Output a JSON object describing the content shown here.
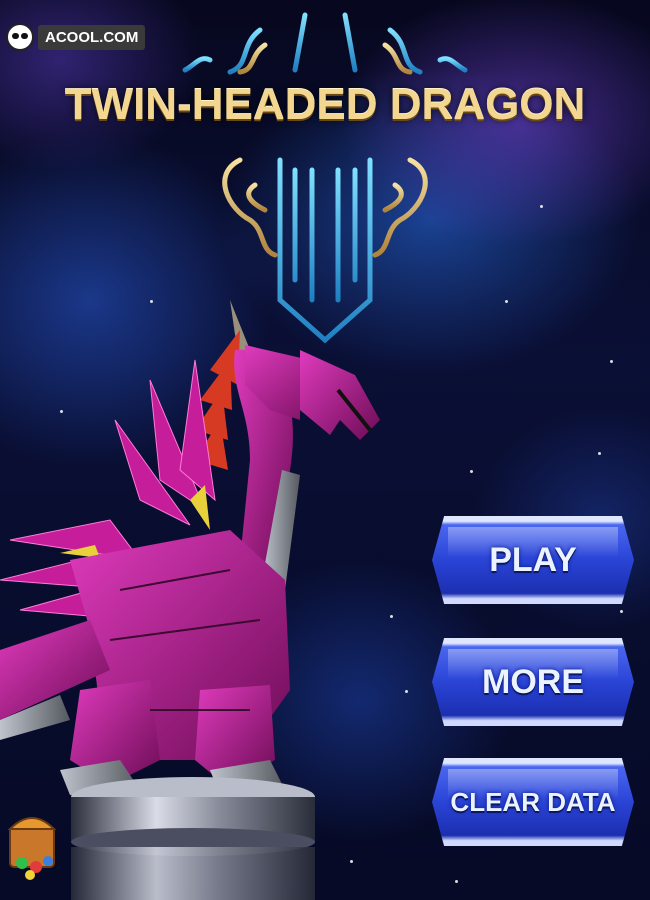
{
  "branding": {
    "site_name": "ACOOL.COM"
  },
  "game": {
    "title": "TWIN-HEADED DRAGON"
  },
  "menu": {
    "play_label": "PLAY",
    "more_label": "MORE",
    "clear_data_label": "CLEAR DATA"
  },
  "colors": {
    "button_blue": "#2a44d6",
    "title_gold": "#f3d690",
    "dragon_magenta": "#a3167a",
    "ornament_cyan": "#3fb7ea"
  },
  "icons": [
    "panda-logo-icon",
    "dragon-crest-icon",
    "treasure-chest-icon"
  ]
}
